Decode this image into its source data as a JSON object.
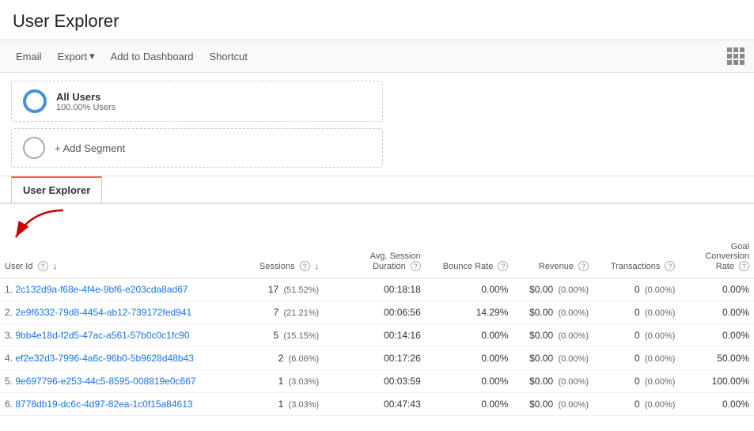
{
  "page": {
    "title": "User Explorer"
  },
  "toolbar": {
    "email_label": "Email",
    "export_label": "Export",
    "add_to_dashboard_label": "Add to Dashboard",
    "shortcut_label": "Shortcut"
  },
  "segments": [
    {
      "name": "All Users",
      "sub": "100.00% Users",
      "type": "active"
    }
  ],
  "add_segment_label": "+ Add Segment",
  "tab": {
    "label": "User Explorer"
  },
  "table": {
    "columns": [
      {
        "id": "userid",
        "label": "User Id",
        "has_help": true,
        "has_sort": true
      },
      {
        "id": "sessions",
        "label": "Sessions",
        "has_help": true,
        "has_sort": true
      },
      {
        "id": "avgsession",
        "label": "Avg. Session Duration",
        "has_help": true,
        "has_sort": false
      },
      {
        "id": "bounce",
        "label": "Bounce Rate",
        "has_help": true,
        "has_sort": false
      },
      {
        "id": "revenue",
        "label": "Revenue",
        "has_help": true,
        "has_sort": false
      },
      {
        "id": "transactions",
        "label": "Transactions",
        "has_help": true,
        "has_sort": false
      },
      {
        "id": "goal",
        "label": "Goal Conversion Rate",
        "has_help": true,
        "has_sort": false
      }
    ],
    "rows": [
      {
        "num": "1.",
        "userid": "2c132d9a-f68e-4f4e-9bf6-e203cda8ad67",
        "sessions": "17",
        "sessions_pct": "51.52%",
        "avgsession": "00:18:18",
        "bounce": "0.00%",
        "revenue": "$0.00",
        "revenue_pct": "0.00%",
        "transactions": "0",
        "transactions_pct": "0.00%",
        "goal": "0.00%"
      },
      {
        "num": "2.",
        "userid": "2e9f6332-79d8-4454-ab12-739172fed941",
        "sessions": "7",
        "sessions_pct": "21.21%",
        "avgsession": "00:06:56",
        "bounce": "14.29%",
        "revenue": "$0.00",
        "revenue_pct": "0.00%",
        "transactions": "0",
        "transactions_pct": "0.00%",
        "goal": "0.00%"
      },
      {
        "num": "3.",
        "userid": "9bb4e18d-f2d5-47ac-a561-57b0c0c1fc90",
        "sessions": "5",
        "sessions_pct": "15.15%",
        "avgsession": "00:14:16",
        "bounce": "0.00%",
        "revenue": "$0.00",
        "revenue_pct": "0.00%",
        "transactions": "0",
        "transactions_pct": "0.00%",
        "goal": "0.00%"
      },
      {
        "num": "4.",
        "userid": "ef2e32d3-7996-4a6c-96b0-5b9628d48b43",
        "sessions": "2",
        "sessions_pct": "6.06%",
        "avgsession": "00:17:26",
        "bounce": "0.00%",
        "revenue": "$0.00",
        "revenue_pct": "0.00%",
        "transactions": "0",
        "transactions_pct": "0.00%",
        "goal": "50.00%"
      },
      {
        "num": "5.",
        "userid": "9e697796-e253-44c5-8595-008819e0c667",
        "sessions": "1",
        "sessions_pct": "3.03%",
        "avgsession": "00:03:59",
        "bounce": "0.00%",
        "revenue": "$0.00",
        "revenue_pct": "0.00%",
        "transactions": "0",
        "transactions_pct": "0.00%",
        "goal": "100.00%"
      },
      {
        "num": "6.",
        "userid": "8778db19-dc6c-4d97-82ea-1c0f15a84613",
        "sessions": "1",
        "sessions_pct": "3.03%",
        "avgsession": "00:47:43",
        "bounce": "0.00%",
        "revenue": "$0.00",
        "revenue_pct": "0.00%",
        "transactions": "0",
        "transactions_pct": "0.00%",
        "goal": "0.00%"
      }
    ]
  }
}
